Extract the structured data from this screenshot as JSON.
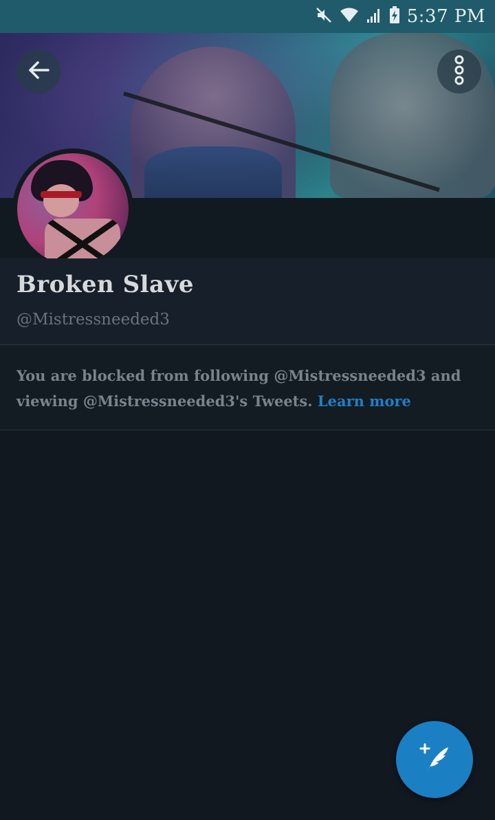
{
  "status_bar": {
    "time": "5:37 PM",
    "icons": [
      "mute-icon",
      "wifi-icon",
      "signal-icon",
      "battery-charging-icon"
    ]
  },
  "header": {
    "back_icon": "arrow-left-icon",
    "more_icon": "more-vertical-icon"
  },
  "profile": {
    "display_name": "Broken Slave",
    "handle": "@Mistressneeded3"
  },
  "blocked_notice": {
    "text": "You are blocked from following @Mistressneeded3 and viewing @Mistressneeded3's Tweets.",
    "link_label": "Learn more"
  },
  "fab": {
    "icon": "compose-tweet-icon"
  },
  "colors": {
    "status_bar_bg": "#1f5b6b",
    "page_bg": "#111820",
    "accent": "#1b7fc4",
    "secondary_text": "#7a838c"
  }
}
